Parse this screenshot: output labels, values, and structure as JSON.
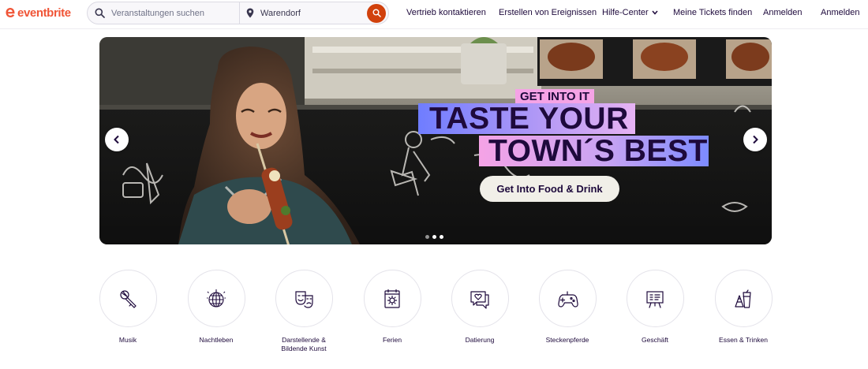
{
  "brand": {
    "name": "eventbrite",
    "color": "#f05537"
  },
  "search": {
    "placeholder": "Veranstaltungen suchen",
    "location_value": "Warendorf",
    "button_color": "#d1410c"
  },
  "nav": {
    "contact_sales": "Vertrieb kontaktieren",
    "create_events": "Erstellen von Ereignissen",
    "help_center": "Hilfe-Center",
    "find_tickets": "Meine Tickets finden",
    "login": "Anmelden",
    "signup": "Anmelden"
  },
  "hero": {
    "tagline": "GET INTO IT",
    "headline_line1": "TASTE YOUR",
    "headline_line2": "TOWN´S BEST",
    "cta": "Get Into Food & Drink",
    "slides": 3,
    "active_slide": 2
  },
  "categories": [
    {
      "label": "Musik",
      "icon": "microphone-icon"
    },
    {
      "label": "Nachtleben",
      "icon": "disco-ball-icon"
    },
    {
      "label": "Darstellende & Bildende Kunst",
      "icon": "theater-masks-icon"
    },
    {
      "label": "Ferien",
      "icon": "calendar-sun-icon"
    },
    {
      "label": "Datierung",
      "icon": "chat-heart-icon"
    },
    {
      "label": "Steckenpferde",
      "icon": "gamepad-icon"
    },
    {
      "label": "Geschäft",
      "icon": "presentation-board-icon"
    },
    {
      "label": "Essen & Trinken",
      "icon": "food-drink-icon"
    }
  ]
}
